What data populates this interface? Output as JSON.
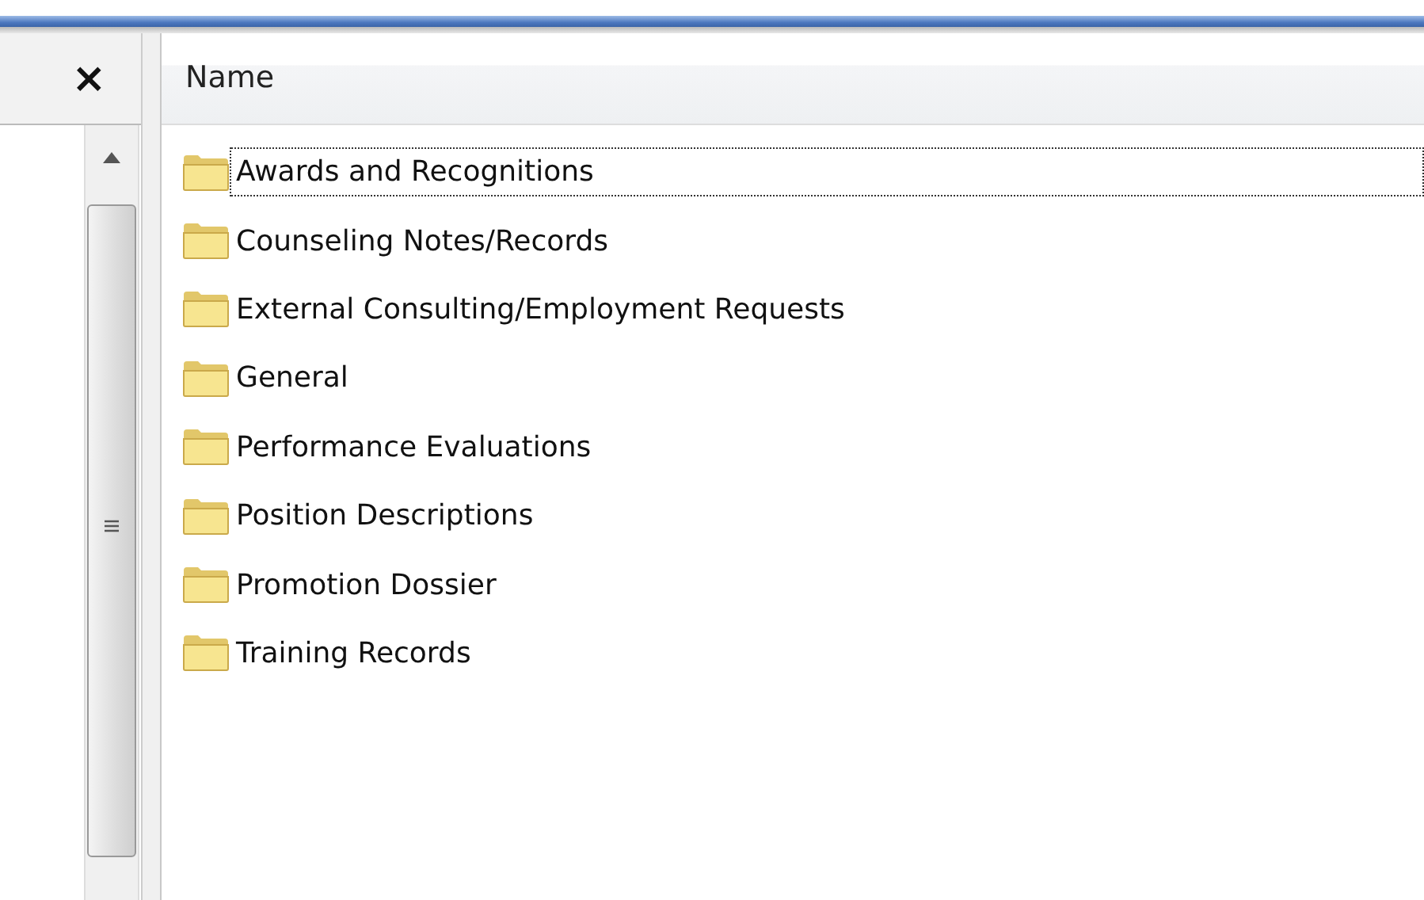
{
  "left_pane": {
    "close_button": "×"
  },
  "file_list": {
    "columns": [
      "Name"
    ],
    "items": [
      {
        "name": "Awards and Recognitions",
        "focused": true
      },
      {
        "name": "Counseling Notes/Records",
        "focused": false
      },
      {
        "name": "External Consulting/Employment Requests",
        "focused": false
      },
      {
        "name": "General",
        "focused": false
      },
      {
        "name": "Performance Evaluations",
        "focused": false
      },
      {
        "name": "Position Descriptions",
        "focused": false
      },
      {
        "name": "Promotion Dossier",
        "focused": false
      },
      {
        "name": "Training Records",
        "focused": false
      }
    ]
  }
}
